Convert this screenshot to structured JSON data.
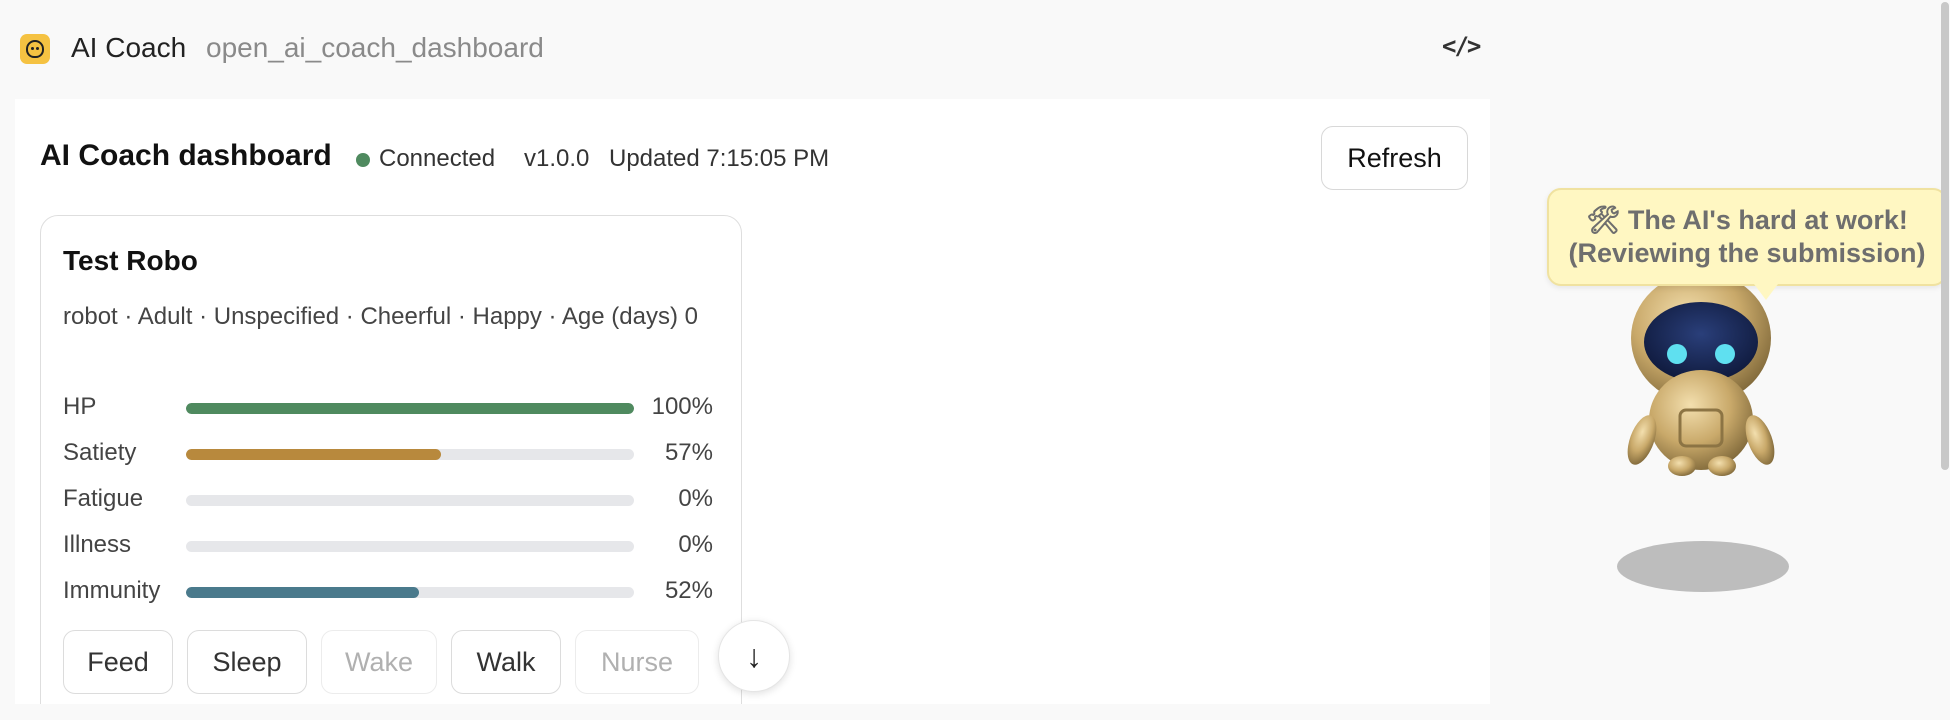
{
  "header": {
    "app_name": "AI Coach",
    "app_subtitle": "open_ai_coach_dashboard",
    "code_icon": "</>"
  },
  "dashboard": {
    "title": "AI Coach dashboard",
    "status": "Connected",
    "status_color": "#4f8a5f",
    "version": "v1.0.0",
    "updated": "Updated 7:15:05 PM",
    "refresh_label": "Refresh"
  },
  "pet": {
    "name": "Test Robo",
    "meta": "robot · Adult · Unspecified · Cheerful · Happy · Age (days) 0",
    "stats": [
      {
        "label": "HP",
        "value": "100%",
        "fraction": 1.0,
        "color": "#4f8a5f"
      },
      {
        "label": "Satiety",
        "value": "57%",
        "fraction": 0.57,
        "color": "#b8893d"
      },
      {
        "label": "Fatigue",
        "value": "0%",
        "fraction": 0.0,
        "color": "#8a8a8a"
      },
      {
        "label": "Illness",
        "value": "0%",
        "fraction": 0.0,
        "color": "#8a8a8a"
      },
      {
        "label": "Immunity",
        "value": "52%",
        "fraction": 0.52,
        "color": "#4a7a8c"
      }
    ],
    "actions": [
      {
        "label": "Feed",
        "enabled": true
      },
      {
        "label": "Sleep",
        "enabled": true
      },
      {
        "label": "Wake",
        "enabled": false
      },
      {
        "label": "Walk",
        "enabled": true
      },
      {
        "label": "Nurse",
        "enabled": false
      }
    ]
  },
  "scroll_icon": "↓",
  "companion": {
    "bubble_line1": "🛠 The AI's hard at work!",
    "bubble_line2": "(Reviewing the submission)"
  }
}
